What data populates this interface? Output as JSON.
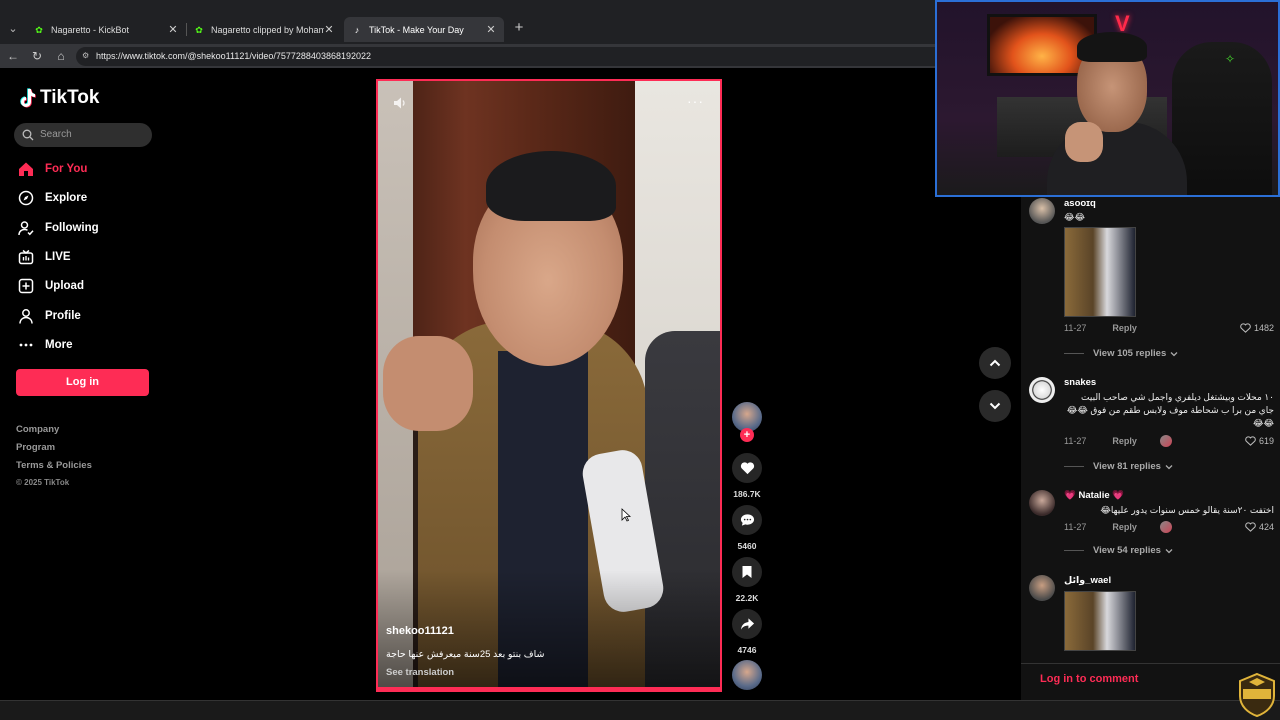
{
  "browser": {
    "tabs": [
      {
        "title": "Nagaretto - KickBot",
        "icon": "kick-icon",
        "active": false
      },
      {
        "title": "Nagaretto clipped by Mohamad_S",
        "icon": "kick-icon",
        "active": false
      },
      {
        "title": "TikTok - Make Your Day",
        "icon": "tiktok-icon",
        "active": true
      }
    ],
    "url": "https://www.tiktok.com/@shekoo11121/video/7577288403868192022"
  },
  "sidebar": {
    "brand": "TikTok",
    "search_placeholder": "Search",
    "nav": [
      {
        "label": "For You",
        "icon": "home-icon",
        "active": true
      },
      {
        "label": "Explore",
        "icon": "compass-icon",
        "active": false
      },
      {
        "label": "Following",
        "icon": "following-icon",
        "active": false
      },
      {
        "label": "LIVE",
        "icon": "live-icon",
        "active": false
      },
      {
        "label": "Upload",
        "icon": "upload-icon",
        "active": false
      },
      {
        "label": "Profile",
        "icon": "profile-icon",
        "active": false
      },
      {
        "label": "More",
        "icon": "more-icon",
        "active": false
      }
    ],
    "login_label": "Log in",
    "footer": [
      "Company",
      "Program",
      "Terms & Policies"
    ],
    "copyright": "© 2025 TikTok"
  },
  "video": {
    "author": "shekoo11121",
    "caption": "شاف بنتو بعد 25سنة ميعرفش عنها حاجة",
    "see_translation": "See translation"
  },
  "actions": {
    "likes": "186.7K",
    "comments": "5460",
    "saves": "22.2K",
    "shares": "4746"
  },
  "comments": {
    "items": [
      {
        "user": "asooɪq",
        "text": "😂😂",
        "date": "11-27",
        "reply_label": "Reply",
        "likes": "1482",
        "has_image": true,
        "view_replies": "View 105 replies"
      },
      {
        "user": "snakes",
        "text": "١٠ محلات وبيشتغل ديلفري واجمل شي صاحب البيت جاي من برا ب شحاطة موف ولابس طقم من فوق 😂😂😂😂",
        "date": "11-27",
        "reply_label": "Reply",
        "likes": "619",
        "has_image": false,
        "view_replies": "View 81 replies"
      },
      {
        "user": "💗 Natalie 💗",
        "text": "اختفت ٢٠سنة يقالو خمس سنوات يدور عليها😂",
        "date": "11-27",
        "reply_label": "Reply",
        "likes": "424",
        "has_image": false,
        "view_replies": "View 54 replies"
      },
      {
        "user": "وائل_wael",
        "text": "",
        "date": "",
        "reply_label": "",
        "likes": "",
        "has_image": true,
        "view_replies": ""
      }
    ],
    "login_prompt": "Log in to comment"
  },
  "colors": {
    "accent": "#fe2c55",
    "background": "#000000",
    "panel": "#121212"
  }
}
